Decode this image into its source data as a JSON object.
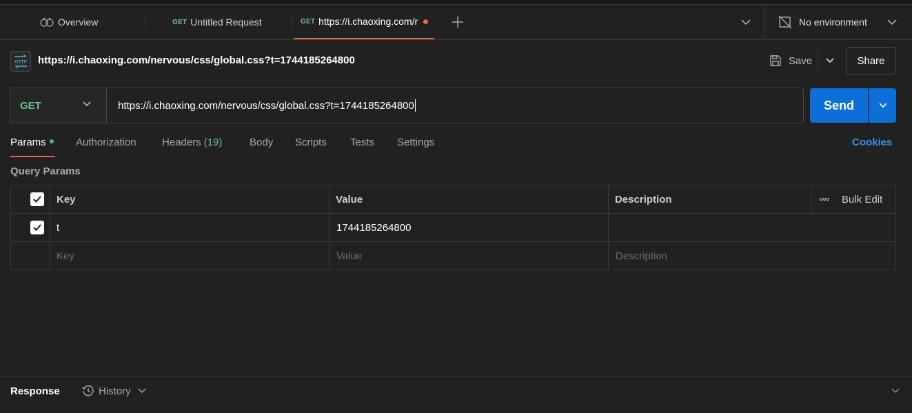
{
  "tabs": {
    "overview_label": "Overview",
    "tab1_method": "GET",
    "tab1_label": "Untitled Request",
    "tab2_method": "GET",
    "tab2_label": "https://i.chaoxing.com/r",
    "environment_label": "No environment"
  },
  "request": {
    "title": "https://i.chaoxing.com/nervous/css/global.css?t=1744185264800",
    "save_label": "Save",
    "share_label": "Share",
    "method": "GET",
    "url": "https://i.chaoxing.com/nervous/css/global.css?t=1744185264800",
    "send_label": "Send"
  },
  "subtabs": {
    "params": "Params",
    "authorization": "Authorization",
    "headers": "Headers",
    "headers_count": "(19)",
    "body": "Body",
    "scripts": "Scripts",
    "tests": "Tests",
    "settings": "Settings",
    "cookies": "Cookies"
  },
  "query_params": {
    "title": "Query Params",
    "columns": {
      "key": "Key",
      "value": "Value",
      "description": "Description",
      "bulk_edit": "Bulk Edit"
    },
    "rows": [
      {
        "checked": true,
        "key": "t",
        "value": "1744185264800",
        "description": ""
      }
    ],
    "placeholder": {
      "key": "Key",
      "value": "Value",
      "description": "Description"
    }
  },
  "response": {
    "title": "Response",
    "history_label": "History"
  },
  "colors": {
    "accent": "#f0643c",
    "send": "#0c6ed6",
    "method_get": "#6bc48c",
    "cookies": "#3d8ff0"
  }
}
